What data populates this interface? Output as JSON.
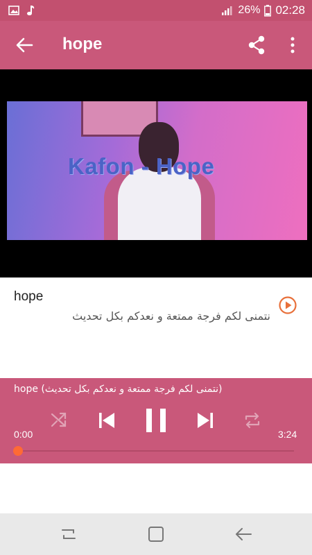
{
  "status_bar": {
    "battery": "26%",
    "time": "02:28"
  },
  "app_bar": {
    "title": "hope"
  },
  "video": {
    "overlay_text": "Kafon - Hope"
  },
  "item": {
    "title": "hope",
    "description": "نتمنى لكم فرجة ممتعة و نعدكم بكل تحديث"
  },
  "player": {
    "now_playing": "hope (نتمنى لكم فرجة ممتعة و نعدكم بكل تحديث)",
    "time_current": "0:00",
    "time_total": "3:24",
    "progress_fraction": 0.0,
    "state": "playing"
  },
  "colors": {
    "status_bar": "#c2506f",
    "app_bar": "#c9587a",
    "accent_orange": "#ff6a35"
  },
  "icons": [
    "image-icon",
    "music-note-icon",
    "signal-icon",
    "battery-icon",
    "back-arrow-icon",
    "share-icon",
    "more-vert-icon",
    "play-circle-icon",
    "shuffle-icon",
    "skip-previous-icon",
    "pause-icon",
    "skip-next-icon",
    "repeat-icon",
    "recents-icon",
    "home-icon",
    "nav-back-icon"
  ]
}
